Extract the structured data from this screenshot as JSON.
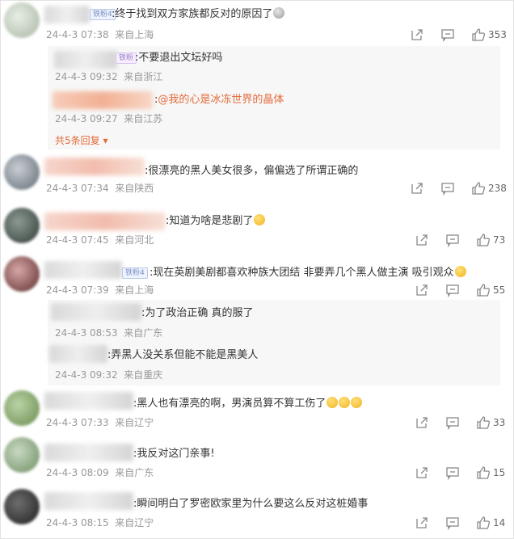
{
  "comments": [
    {
      "badge": "铁粉4",
      "text": ":终于找到双方家族都反对的原因了",
      "time": "24-4-3 07:38",
      "location": "来自上海",
      "likes": "353",
      "replies": [
        {
          "badge": "铁粉",
          "text": ":不要退出文坛好吗",
          "time": "24-4-3 09:32",
          "location": "来自浙江"
        },
        {
          "text_prefix": ":",
          "mention": "@我的心是冰冻世界的晶体",
          "time": "24-4-3 09:27",
          "location": "来自江苏"
        }
      ],
      "more_replies": "共5条回复"
    },
    {
      "text": ":很漂亮的黑人美女很多，偏偏选了所谓正确的",
      "time": "24-4-3 07:34",
      "location": "来自陕西",
      "likes": "238"
    },
    {
      "text": ":知道为啥是悲剧了",
      "time": "24-4-3 07:45",
      "location": "来自河北",
      "likes": "73"
    },
    {
      "badge": "铁粉4",
      "text": ":现在英剧美剧都喜欢种族大团结 非要弄几个黑人做主演 吸引观众",
      "time": "24-4-3 07:39",
      "location": "来自上海",
      "likes": "55",
      "replies": [
        {
          "text": ":为了政治正确 真的服了",
          "time": "24-4-3 08:53",
          "location": "来自广东"
        },
        {
          "text": ":弄黑人没关系但能不能是黑美人",
          "time": "24-4-3 09:32",
          "location": "来自重庆"
        }
      ]
    },
    {
      "text": ":黑人也有漂亮的啊，男演员算不算工伤了",
      "time": "24-4-3 07:33",
      "location": "来自辽宁",
      "likes": "33"
    },
    {
      "text": ":我反对这门亲事!",
      "time": "24-4-3 08:09",
      "location": "来自广东",
      "likes": "15"
    },
    {
      "text": ":瞬间明白了罗密欧家里为什么要这么反对这桩婚事",
      "time": "24-4-3 08:15",
      "location": "来自辽宁",
      "likes": "14"
    }
  ],
  "colors": {
    "accent": "#e36a3a",
    "meta": "#999999"
  },
  "icons": {
    "share": "share-icon",
    "comment": "comment-icon",
    "like": "thumbs-up-icon"
  }
}
